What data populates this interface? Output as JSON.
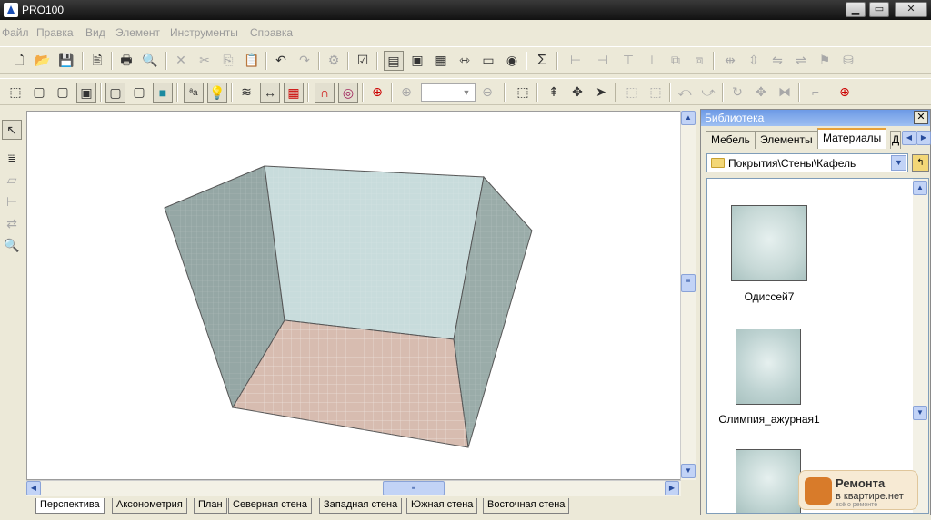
{
  "window": {
    "title": "PRO100"
  },
  "menu": [
    "Файл",
    "Правка",
    "Вид",
    "Элемент",
    "Инструменты",
    "Справка"
  ],
  "viewport": {
    "tabs": [
      "Перспектива",
      "Аксонометрия",
      "План",
      "Северная стена",
      "Западная стена",
      "Южная стена",
      "Восточная стена"
    ],
    "active_tab": "Перспектива",
    "colors": {
      "left_wall": "#95a7a5",
      "back_wall": "#c8dcdc",
      "right_wall": "#9aaca9",
      "floor": "#d7bcb0"
    }
  },
  "library": {
    "title": "Библиотека",
    "tabs": [
      "Мебель",
      "Элементы",
      "Материалы",
      "Д"
    ],
    "active_tab": "Материалы",
    "path": "Покрытия\\Стены\\Кафель",
    "items": [
      {
        "label": "Одиссей7",
        "color": "#c6d8d6"
      },
      {
        "label": "Олимпия_ажурная1",
        "color": "#bdd2d1"
      },
      {
        "label": "",
        "color": "#c2d6d4"
      }
    ]
  },
  "watermark": {
    "line1": "Ремонта",
    "line2": "в квартире.нет",
    "line3": "всё о ремонте"
  },
  "glyphs": {
    "sigma": "Σ",
    "ab": "ªa"
  }
}
